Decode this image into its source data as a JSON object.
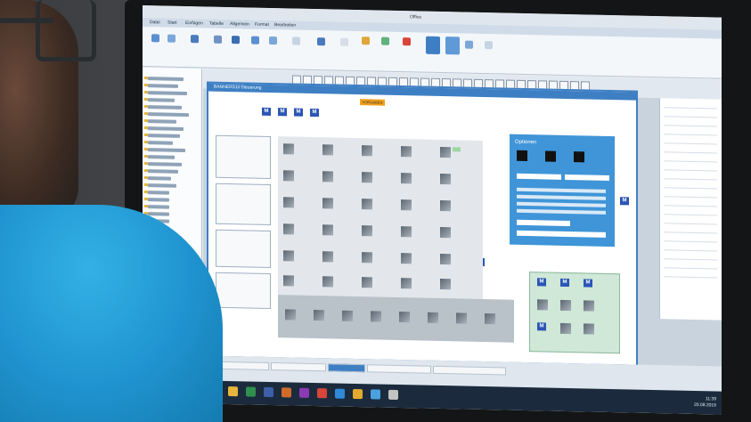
{
  "app": {
    "title": "Office",
    "tabs": [
      "Datei",
      "Start",
      "Einfügen",
      "Tabelle",
      "Allgemein",
      "Format",
      "Bearbeiten"
    ],
    "colors": {
      "accent": "#3e7fc4",
      "options": "#3f95d8",
      "vorgabe": "#f2a01b",
      "green_panel": "#cfe8d8",
      "taskbar": "#1b2b3d"
    }
  },
  "dialog": {
    "title": "BANNER3.bl Steuerung",
    "badge": "VORGABEN",
    "options_title": "Optionen"
  },
  "icons": [
    "folder-icon",
    "grid-cell-icon",
    "options-icon",
    "m-icon",
    "windows-start-icon"
  ],
  "clock": {
    "time": "11:39",
    "date": "20.08.2016"
  }
}
